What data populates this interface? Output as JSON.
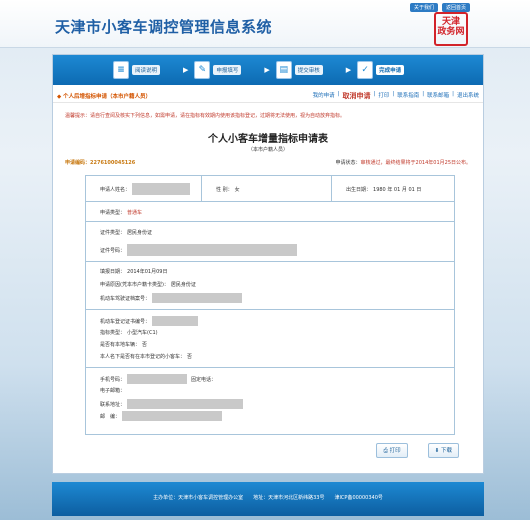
{
  "site": {
    "title": "天津市小客车调控管理信息系统",
    "top_links": [
      "关于我们",
      "返回首页"
    ],
    "logo_text": "政务网"
  },
  "steps": [
    {
      "label": "阅读说明",
      "icon": "book-icon"
    },
    {
      "label": "申报填写",
      "icon": "pencil-icon"
    },
    {
      "label": "提交审核",
      "icon": "document-icon"
    },
    {
      "label": "完成申请",
      "icon": "check-icon"
    }
  ],
  "crumb": {
    "text": "个人后增指标申请（本市户籍人员）"
  },
  "nav_links": [
    "我的申请",
    "取消申请",
    "打印",
    "联系指南",
    "联系邮箱",
    "退出系统"
  ],
  "notice": "温馨提示：请自行查阅及核实下列信息，如需申请，请在指标有效期内使用该指标登记，过期将无法使用，视为自动放弃指标。",
  "form": {
    "title": "个人小客车增量指标申请表",
    "subtitle": "（本市户籍人员）",
    "app_code_label": "申请编码：",
    "app_code": "2276100045126",
    "status_label": "申请状态：",
    "status_value": "审核通过，最终结果将于2014年01月25日公布。",
    "name_label": "申请人姓名：",
    "gender_label": "性 别：",
    "gender": "女",
    "birth_label": "出生日期：",
    "birth": "1980 年 01 月 01 日",
    "app_type_label": "申请类型：",
    "app_type": "普通车",
    "id_type_label": "证件类型：",
    "id_type": "居民身份证",
    "id_no_label": "证件号码：",
    "fill_date_label": "填报日期：",
    "fill_date": "2014年01月09日",
    "reason_label": "申请原因(凭本市户籍卡类型)：",
    "reason": "居民身份证",
    "driver_label": "机动车驾驶证档案号：",
    "vehicle_label": "机动车登记证书编号：",
    "car_type_label": "指标类型：",
    "car_type": "小型汽车(C1)",
    "has_car_label": "是否有本地车辆：",
    "has_car": "否",
    "transfer_label": "本人名下是否有在本市登记的小客车：",
    "transfer": "否",
    "mobile_label": "手机号码：",
    "phone_label": "固定电话：",
    "email_label": "电子邮箱：",
    "address_label": "联系地址：",
    "zip_label": "邮　编："
  },
  "buttons": {
    "print": "打印",
    "download": "下载"
  },
  "footer": "主办单位：天津市小客车调控管理办公室　　地址：天津市河北区新纬路33号　　津ICP备00000340号"
}
